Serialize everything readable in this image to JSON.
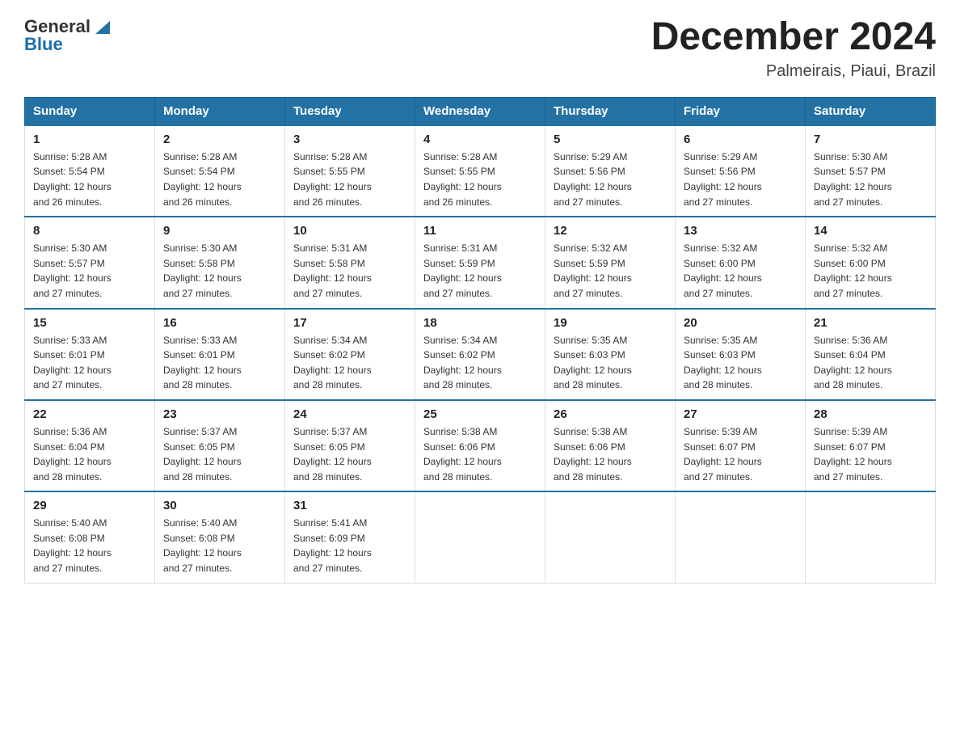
{
  "logo": {
    "text_general": "General",
    "text_blue": "Blue"
  },
  "header": {
    "month_title": "December 2024",
    "location": "Palmeirais, Piaui, Brazil"
  },
  "weekdays": [
    "Sunday",
    "Monday",
    "Tuesday",
    "Wednesday",
    "Thursday",
    "Friday",
    "Saturday"
  ],
  "weeks": [
    [
      {
        "day": "1",
        "sunrise": "5:28 AM",
        "sunset": "5:54 PM",
        "daylight": "12 hours and 26 minutes."
      },
      {
        "day": "2",
        "sunrise": "5:28 AM",
        "sunset": "5:54 PM",
        "daylight": "12 hours and 26 minutes."
      },
      {
        "day": "3",
        "sunrise": "5:28 AM",
        "sunset": "5:55 PM",
        "daylight": "12 hours and 26 minutes."
      },
      {
        "day": "4",
        "sunrise": "5:28 AM",
        "sunset": "5:55 PM",
        "daylight": "12 hours and 26 minutes."
      },
      {
        "day": "5",
        "sunrise": "5:29 AM",
        "sunset": "5:56 PM",
        "daylight": "12 hours and 27 minutes."
      },
      {
        "day": "6",
        "sunrise": "5:29 AM",
        "sunset": "5:56 PM",
        "daylight": "12 hours and 27 minutes."
      },
      {
        "day": "7",
        "sunrise": "5:30 AM",
        "sunset": "5:57 PM",
        "daylight": "12 hours and 27 minutes."
      }
    ],
    [
      {
        "day": "8",
        "sunrise": "5:30 AM",
        "sunset": "5:57 PM",
        "daylight": "12 hours and 27 minutes."
      },
      {
        "day": "9",
        "sunrise": "5:30 AM",
        "sunset": "5:58 PM",
        "daylight": "12 hours and 27 minutes."
      },
      {
        "day": "10",
        "sunrise": "5:31 AM",
        "sunset": "5:58 PM",
        "daylight": "12 hours and 27 minutes."
      },
      {
        "day": "11",
        "sunrise": "5:31 AM",
        "sunset": "5:59 PM",
        "daylight": "12 hours and 27 minutes."
      },
      {
        "day": "12",
        "sunrise": "5:32 AM",
        "sunset": "5:59 PM",
        "daylight": "12 hours and 27 minutes."
      },
      {
        "day": "13",
        "sunrise": "5:32 AM",
        "sunset": "6:00 PM",
        "daylight": "12 hours and 27 minutes."
      },
      {
        "day": "14",
        "sunrise": "5:32 AM",
        "sunset": "6:00 PM",
        "daylight": "12 hours and 27 minutes."
      }
    ],
    [
      {
        "day": "15",
        "sunrise": "5:33 AM",
        "sunset": "6:01 PM",
        "daylight": "12 hours and 27 minutes."
      },
      {
        "day": "16",
        "sunrise": "5:33 AM",
        "sunset": "6:01 PM",
        "daylight": "12 hours and 28 minutes."
      },
      {
        "day": "17",
        "sunrise": "5:34 AM",
        "sunset": "6:02 PM",
        "daylight": "12 hours and 28 minutes."
      },
      {
        "day": "18",
        "sunrise": "5:34 AM",
        "sunset": "6:02 PM",
        "daylight": "12 hours and 28 minutes."
      },
      {
        "day": "19",
        "sunrise": "5:35 AM",
        "sunset": "6:03 PM",
        "daylight": "12 hours and 28 minutes."
      },
      {
        "day": "20",
        "sunrise": "5:35 AM",
        "sunset": "6:03 PM",
        "daylight": "12 hours and 28 minutes."
      },
      {
        "day": "21",
        "sunrise": "5:36 AM",
        "sunset": "6:04 PM",
        "daylight": "12 hours and 28 minutes."
      }
    ],
    [
      {
        "day": "22",
        "sunrise": "5:36 AM",
        "sunset": "6:04 PM",
        "daylight": "12 hours and 28 minutes."
      },
      {
        "day": "23",
        "sunrise": "5:37 AM",
        "sunset": "6:05 PM",
        "daylight": "12 hours and 28 minutes."
      },
      {
        "day": "24",
        "sunrise": "5:37 AM",
        "sunset": "6:05 PM",
        "daylight": "12 hours and 28 minutes."
      },
      {
        "day": "25",
        "sunrise": "5:38 AM",
        "sunset": "6:06 PM",
        "daylight": "12 hours and 28 minutes."
      },
      {
        "day": "26",
        "sunrise": "5:38 AM",
        "sunset": "6:06 PM",
        "daylight": "12 hours and 28 minutes."
      },
      {
        "day": "27",
        "sunrise": "5:39 AM",
        "sunset": "6:07 PM",
        "daylight": "12 hours and 27 minutes."
      },
      {
        "day": "28",
        "sunrise": "5:39 AM",
        "sunset": "6:07 PM",
        "daylight": "12 hours and 27 minutes."
      }
    ],
    [
      {
        "day": "29",
        "sunrise": "5:40 AM",
        "sunset": "6:08 PM",
        "daylight": "12 hours and 27 minutes."
      },
      {
        "day": "30",
        "sunrise": "5:40 AM",
        "sunset": "6:08 PM",
        "daylight": "12 hours and 27 minutes."
      },
      {
        "day": "31",
        "sunrise": "5:41 AM",
        "sunset": "6:09 PM",
        "daylight": "12 hours and 27 minutes."
      },
      null,
      null,
      null,
      null
    ]
  ],
  "labels": {
    "sunrise": "Sunrise:",
    "sunset": "Sunset:",
    "daylight": "Daylight:"
  },
  "colors": {
    "header_bg": "#2472a4",
    "accent": "#1a6faf"
  }
}
